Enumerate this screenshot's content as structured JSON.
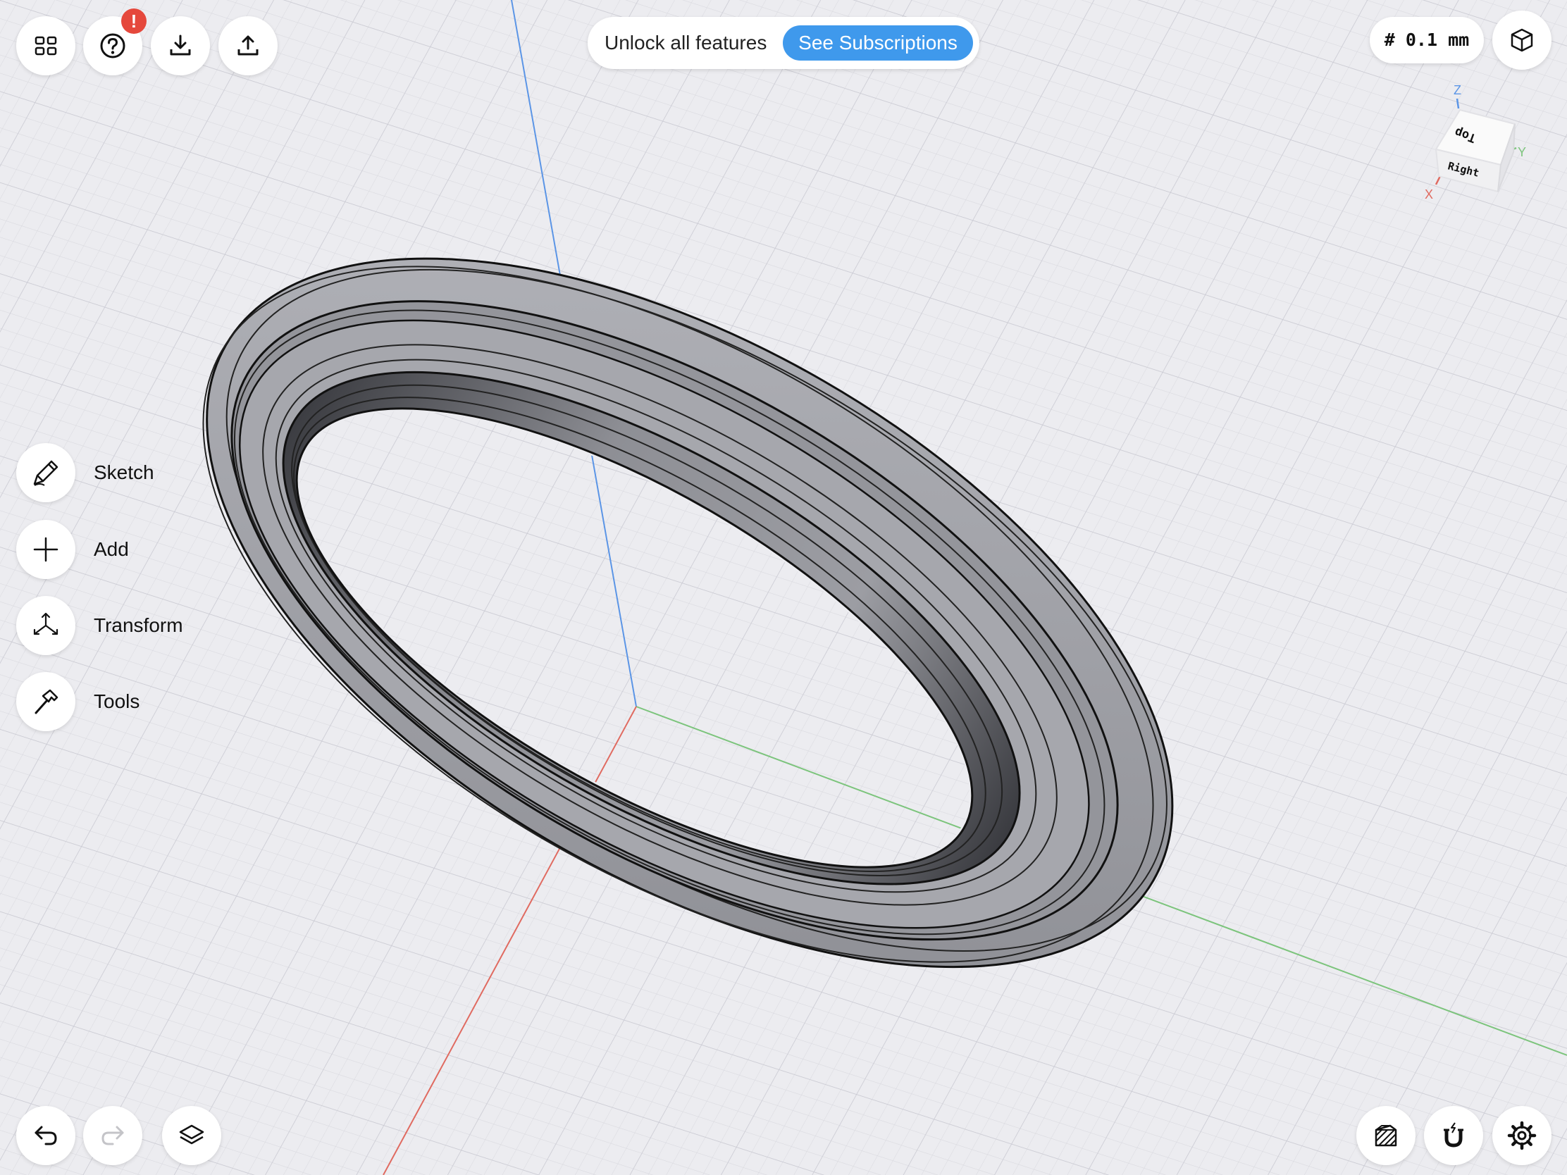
{
  "banner": {
    "text": "Unlock all features",
    "button_label": "See Subscriptions"
  },
  "notification": {
    "badge": "!"
  },
  "grid_setting": {
    "label": "# 0.1 mm"
  },
  "view_cube": {
    "top_label": "Top",
    "right_label": "Right",
    "axis_z": "Z",
    "axis_y": "Y",
    "axis_x": "X"
  },
  "tools": {
    "sketch": "Sketch",
    "add": "Add",
    "transform": "Transform",
    "tools": "Tools"
  },
  "colors": {
    "accent": "#3f99ec",
    "badge": "#e5483c",
    "axis_x": "#e06a60",
    "axis_y": "#7cc47c",
    "axis_z": "#5b95e6"
  },
  "icons": {
    "top_left": [
      "grid-menu-icon",
      "help-icon",
      "import-icon",
      "export-icon"
    ],
    "top_right": [
      "view-mode-cube-icon"
    ],
    "left_toolbar": [
      "pencil-icon",
      "plus-icon",
      "transform-arrows-icon",
      "hammer-icon"
    ],
    "bottom_left": [
      "undo-icon",
      "redo-icon",
      "layers-icon"
    ],
    "bottom_right": [
      "shading-mode-icon",
      "snap-magnet-icon",
      "settings-gear-icon"
    ]
  }
}
